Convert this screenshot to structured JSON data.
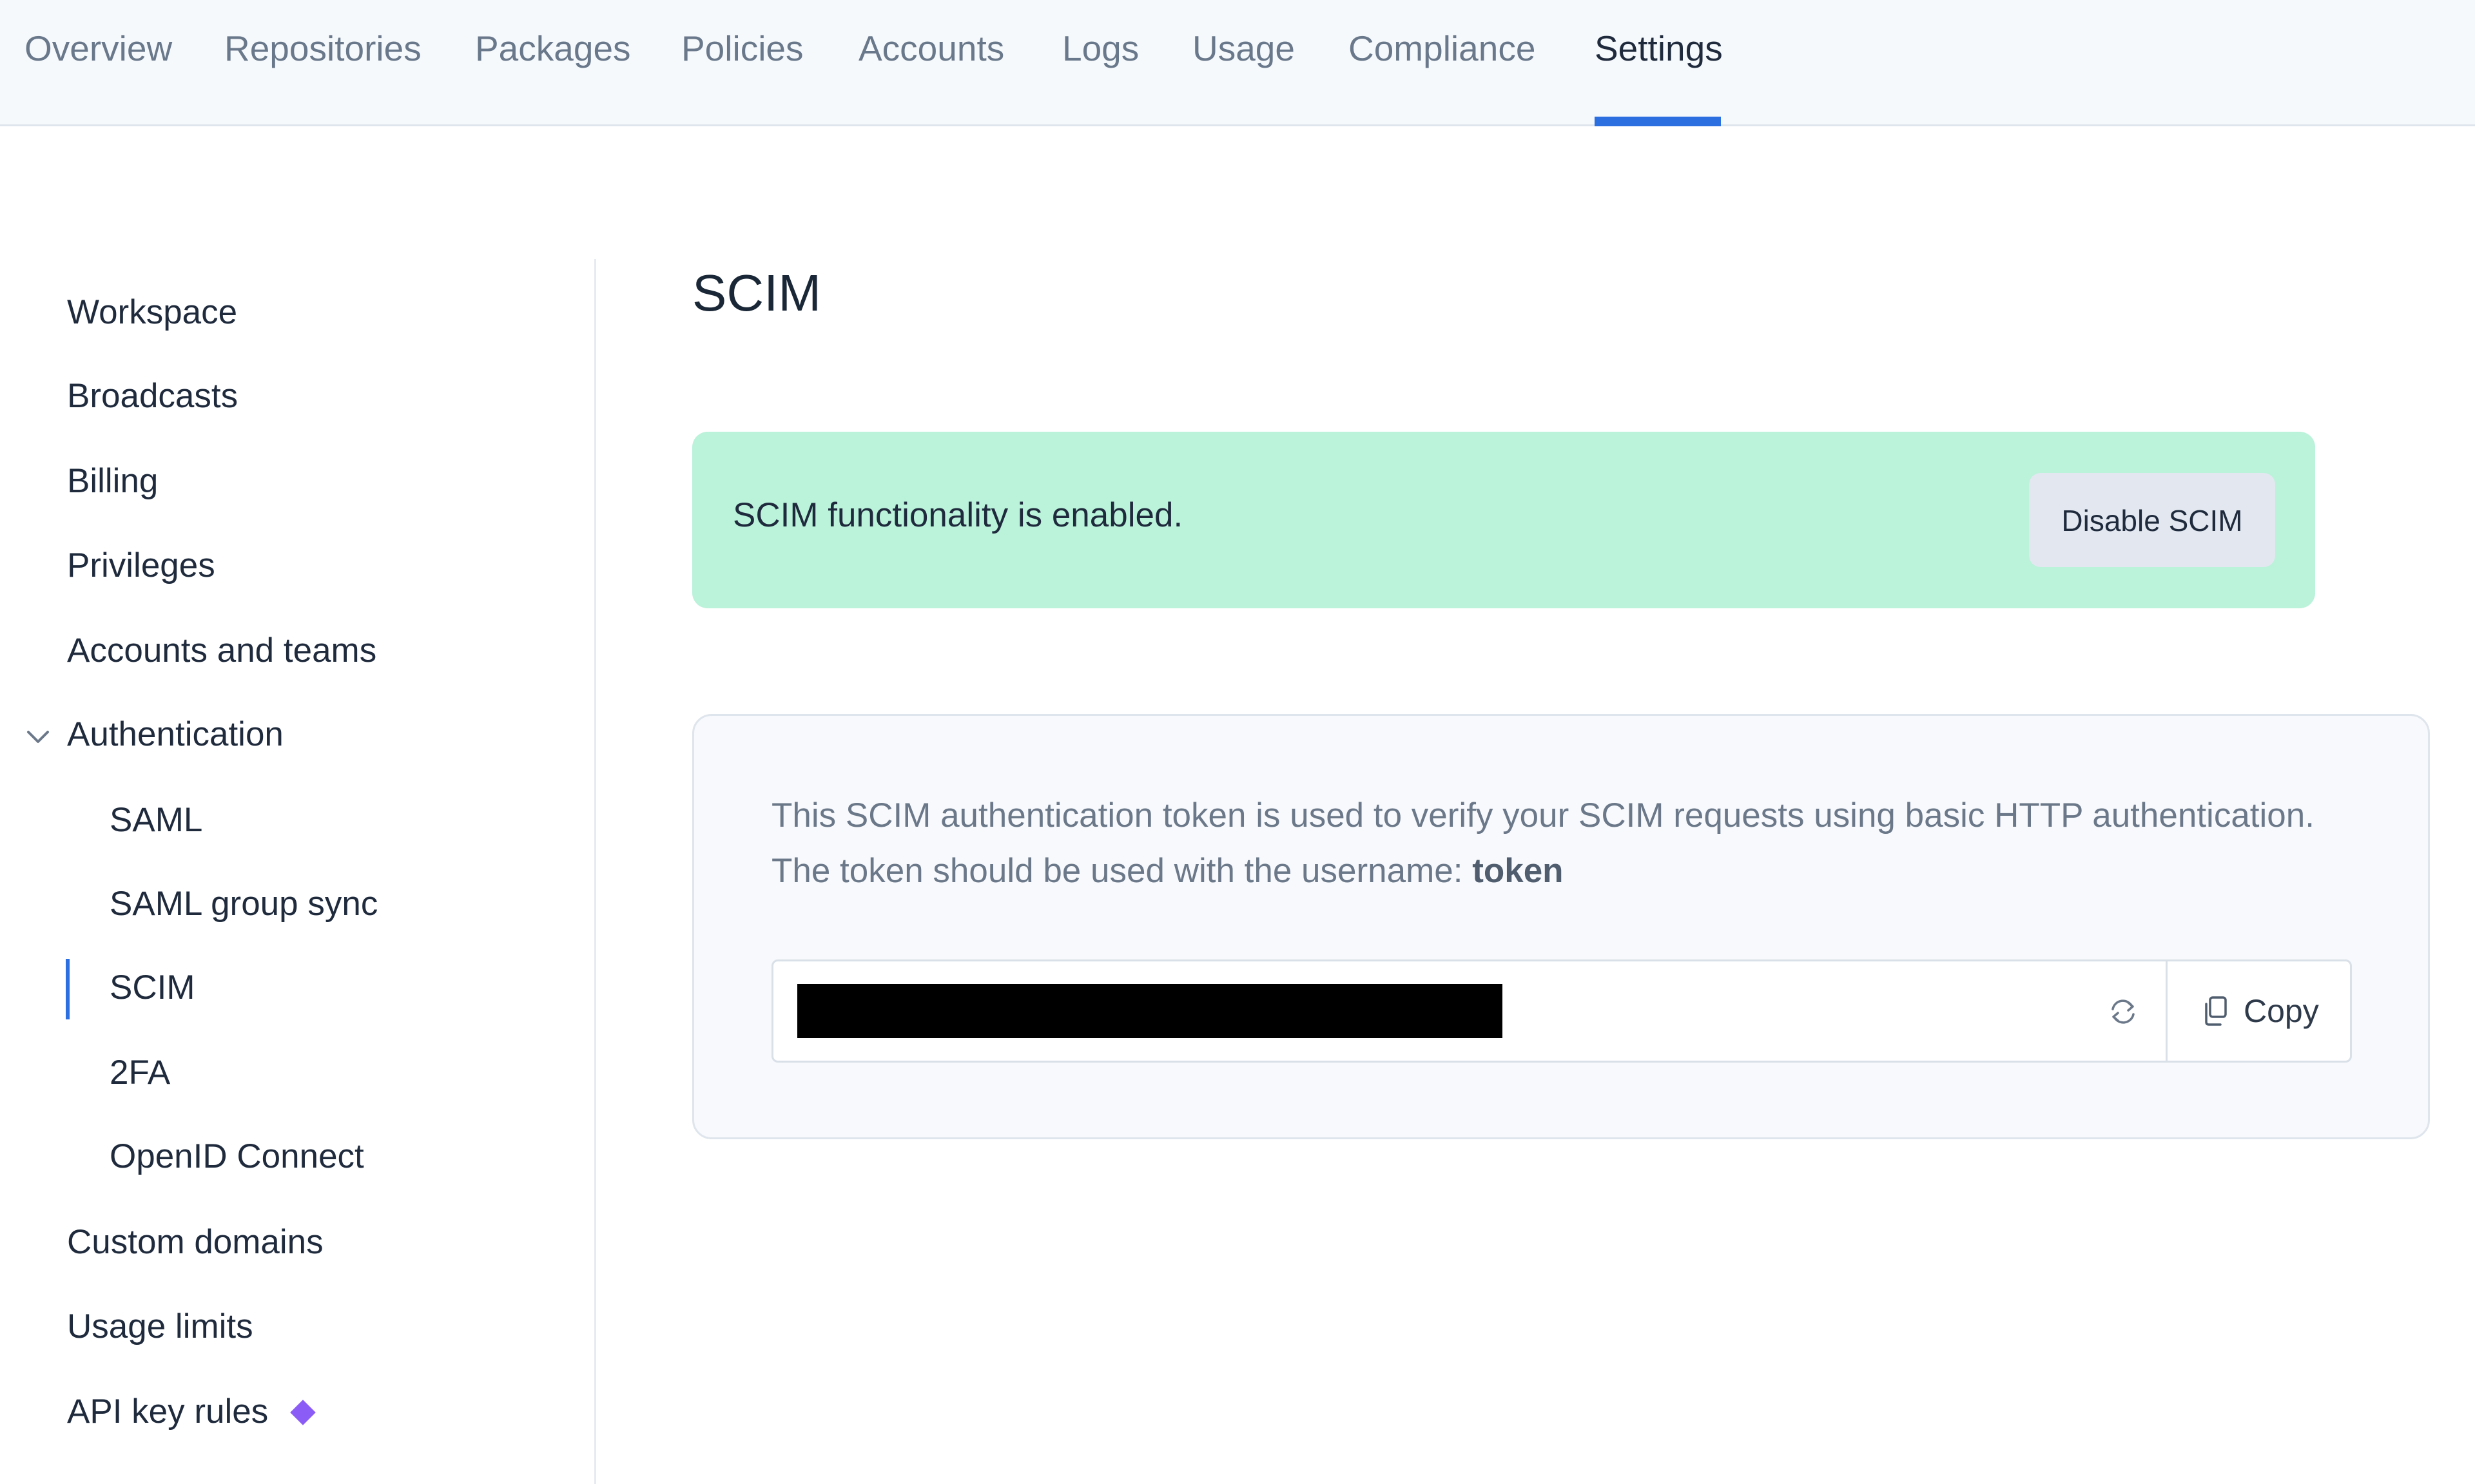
{
  "top_nav": {
    "tabs": [
      {
        "label": "Overview"
      },
      {
        "label": "Repositories"
      },
      {
        "label": "Packages"
      },
      {
        "label": "Policies"
      },
      {
        "label": "Accounts"
      },
      {
        "label": "Logs"
      },
      {
        "label": "Usage"
      },
      {
        "label": "Compliance"
      },
      {
        "label": "Settings",
        "active": true
      }
    ]
  },
  "sidebar": {
    "items": [
      {
        "label": "Workspace"
      },
      {
        "label": "Broadcasts"
      },
      {
        "label": "Billing"
      },
      {
        "label": "Privileges"
      },
      {
        "label": "Accounts and teams"
      },
      {
        "label": "Authentication",
        "expanded": true
      },
      {
        "label": "SAML"
      },
      {
        "label": "SAML group sync"
      },
      {
        "label": "SCIM",
        "active": true
      },
      {
        "label": "2FA"
      },
      {
        "label": "OpenID Connect"
      },
      {
        "label": "Custom domains"
      },
      {
        "label": "Usage limits"
      },
      {
        "label": "API key rules",
        "badge_icon": "diamond-icon",
        "badge_color": "#8b5cf6"
      }
    ]
  },
  "main": {
    "title": "SCIM",
    "banner": {
      "message": "SCIM functionality is enabled.",
      "button_label": "Disable SCIM",
      "color": "#baf2da"
    },
    "token_card": {
      "description": "This SCIM authentication token is used to verify your SCIM requests using basic HTTP authentication. The token should be used with the username: ",
      "username": "token",
      "token_value": "(redacted)",
      "refresh_icon": "refresh-icon",
      "copy_label": "Copy",
      "copy_icon": "copy-icon"
    }
  },
  "colors": {
    "accent": "#2b6fe0",
    "success_bg": "#baf2da",
    "badge": "#8b5cf6"
  }
}
